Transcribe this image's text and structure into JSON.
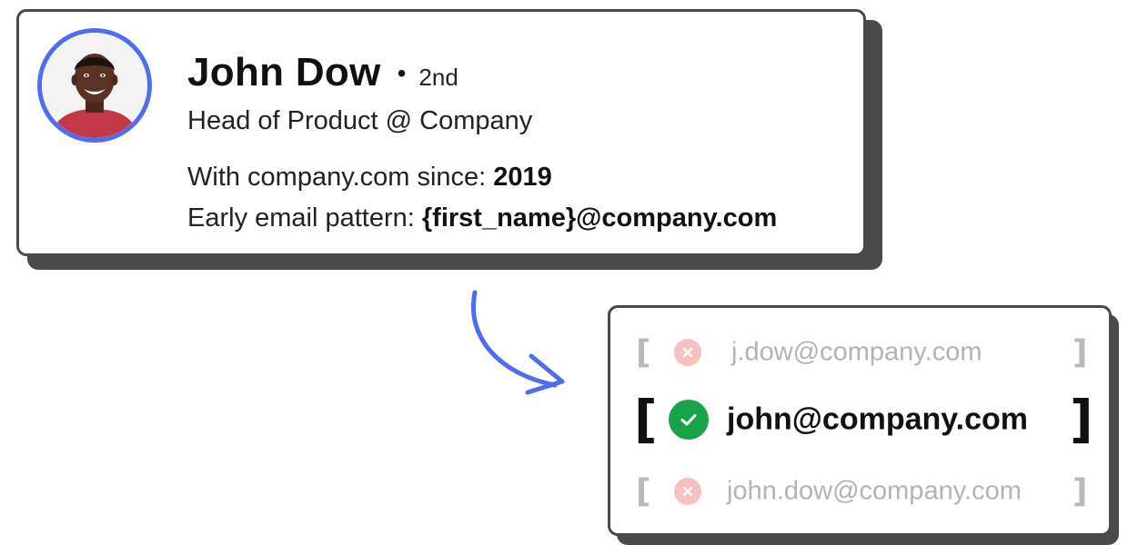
{
  "profile": {
    "name": "John Dow",
    "separator": "•",
    "connection_degree": "2nd",
    "headline": "Head of Product @ Company",
    "since_label": "With company.com since:",
    "since_value": "2019",
    "pattern_label": "Early email pattern:",
    "pattern_value": "{first_name}@company.com",
    "accent_color": "#4f6df0"
  },
  "results": {
    "items": [
      {
        "email": "j.dow@company.com",
        "status": "invalid",
        "icon": "x-icon",
        "bracket_open": "[",
        "bracket_close": "]"
      },
      {
        "email": "john@company.com",
        "status": "valid",
        "icon": "check-icon",
        "bracket_open": "[",
        "bracket_close": "]"
      },
      {
        "email": "john.dow@company.com",
        "status": "invalid",
        "icon": "x-icon",
        "bracket_open": "[",
        "bracket_close": "]"
      }
    ],
    "valid_color": "#16a34a",
    "invalid_color": "#f7c1c4"
  },
  "arrow_icon": "curved-arrow-icon"
}
